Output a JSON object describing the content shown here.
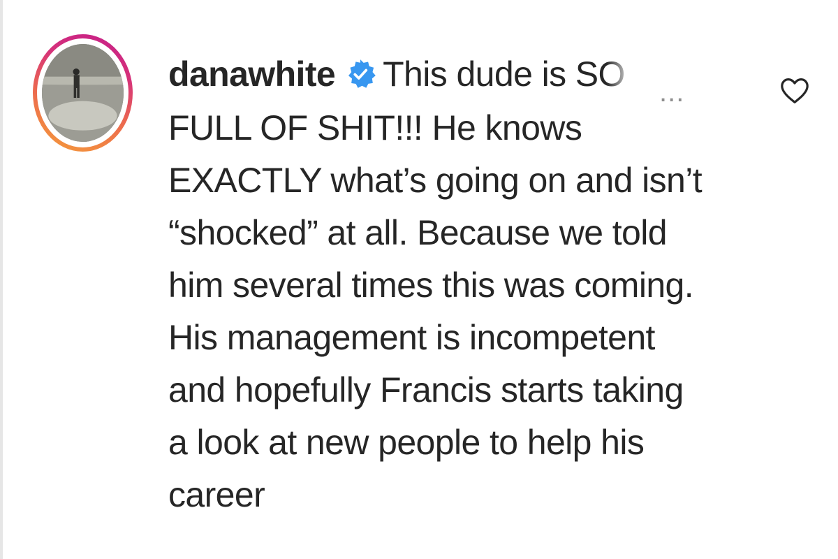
{
  "comment": {
    "username": "danawhite",
    "verified": true,
    "first_line_text": "This dude is SO",
    "more_label": "...",
    "continuation_lines": [
      "FULL OF SHIT!!! He knows",
      "EXACTLY what’s going on and isn’t",
      "“shocked” at all. Because we told",
      "him several times this was coming.",
      "His management is incompetent",
      "and hopefully Francis starts taking",
      "a look at new people to help his",
      "career"
    ]
  },
  "icons": {
    "verified": "verified-badge-icon",
    "more": "more-options-icon",
    "like": "heart-icon"
  },
  "colors": {
    "text": "#262626",
    "verified_badge": "#3897f0",
    "story_ring_start": "#f59d3a",
    "story_ring_end": "#c41d8a",
    "muted": "#8e8e8e"
  }
}
